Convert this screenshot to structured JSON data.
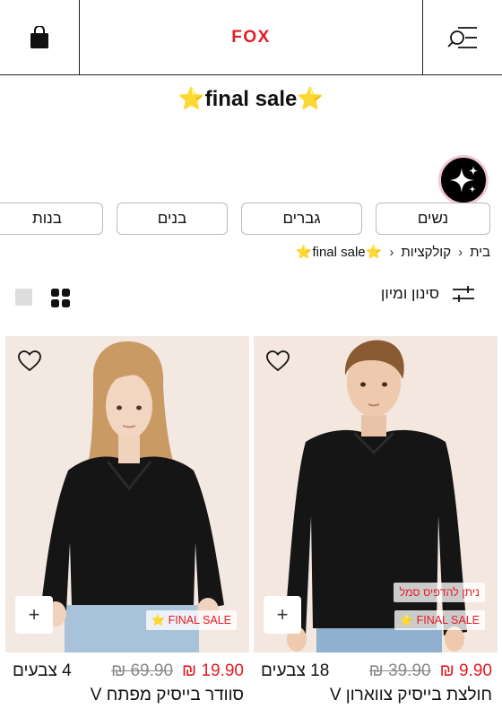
{
  "header": {
    "logo": "FOX",
    "cart_icon": "shopping-bag-icon",
    "menu_icon": "search-menu-icon"
  },
  "title": {
    "star_left": "⭐",
    "text": "final sale",
    "star_right": "⭐"
  },
  "categories": [
    "נשים",
    "גברים",
    "בנים",
    "בנות"
  ],
  "breadcrumb": {
    "home": "בית",
    "collections": "קולקציות",
    "current_star_left": "⭐",
    "current": "final sale",
    "current_star_right": "⭐"
  },
  "filter": {
    "label": "סינון ומיון"
  },
  "products": [
    {
      "name": "חולצת בייסיק צווארון V",
      "price": "9.90 ₪",
      "old_price": "39.90 ₪",
      "colors": "18 צבעים",
      "badge_final": "FINAL SALE",
      "badge_print": "ניתן להדפיס סמל",
      "badge_star": "⭐",
      "plus": "+"
    },
    {
      "name": "סוודר בייסיק מפתח V",
      "price": "19.90 ₪",
      "old_price": "69.90 ₪",
      "colors": "4 צבעים",
      "badge_final": "FINAL SALE",
      "badge_star": "⭐",
      "plus": "+"
    }
  ],
  "colors": {
    "brand_red": "#e31b23",
    "image_bg": "#f3e7df",
    "sweater": "#151515"
  }
}
